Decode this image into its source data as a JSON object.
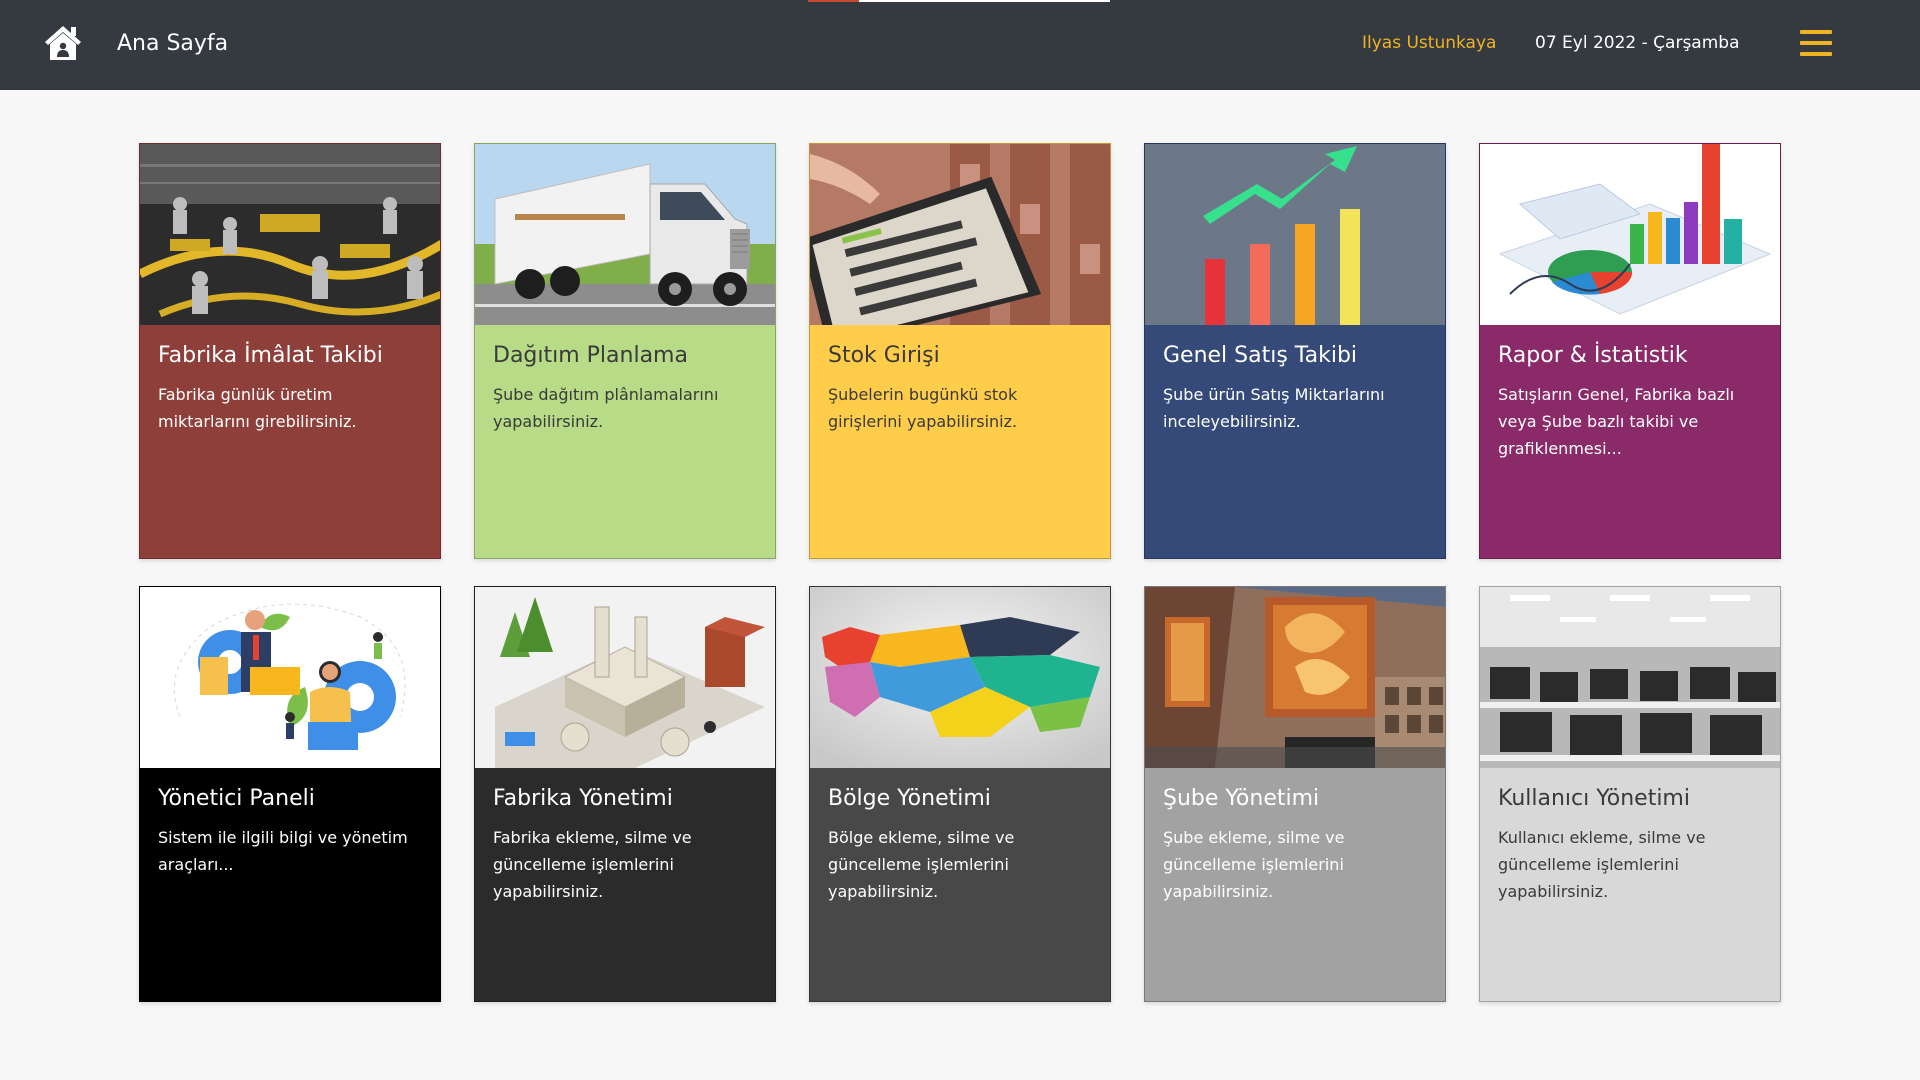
{
  "header": {
    "title": "Ana Sayfa",
    "user": "Ilyas Ustunkaya",
    "date": "07 Eyl 2022 - Çarşamba",
    "icons": {
      "home": "home-icon",
      "menu": "hamburger-menu-icon"
    },
    "colors": {
      "background": "#343a40",
      "user_text": "#f0b321",
      "menu_icon": "#f0b321"
    },
    "loading_progress": 0.17
  },
  "cards": [
    {
      "title": "Fabrika İmâlat Takibi",
      "text": "Fabrika günlük üretim miktarlarını girebilirsiniz.",
      "image": "factory-production-line-photo",
      "bg": "#8e3f3a",
      "fg": "#ffffff"
    },
    {
      "title": "Dağıtım Planlama",
      "text": "Şube dağıtım plânlamalarını yapabilirsiniz.",
      "image": "delivery-truck-photo",
      "bg": "#b7db86",
      "fg": "#3a3a3a"
    },
    {
      "title": "Stok Girişi",
      "text": "Şubelerin bugünkü stok girişlerini yapabilirsiniz.",
      "image": "inventory-tracking-tablet-photo",
      "bg": "#ffcd4a",
      "fg": "#3a3a3a"
    },
    {
      "title": "Genel Satış Takibi",
      "text": "Şube ürün Satış Miktarlarını inceleyebilirsiniz.",
      "image": "sales-growth-bar-chart-illustration",
      "bg": "#354a78",
      "fg": "#ffffff"
    },
    {
      "title": "Rapor & İstatistik",
      "text": "Satışların Genel, Fabrika bazlı veya Şube bazlı takibi ve grafiklenmesi...",
      "image": "report-statistics-3d-charts-illustration",
      "bg": "#8a2a68",
      "fg": "#ffffff"
    },
    {
      "title": "Yönetici Paneli",
      "text": "Sistem ile ilgili bilgi ve yönetim araçları...",
      "image": "admin-team-gears-illustration",
      "bg": "#000000",
      "fg": "#ffffff"
    },
    {
      "title": "Fabrika Yönetimi",
      "text": "Fabrika ekleme, silme ve güncelleme işlemlerini yapabilirsiniz.",
      "image": "isometric-factory-illustration",
      "bg": "#2b2b2b",
      "fg": "#ffffff"
    },
    {
      "title": "Bölge Yönetimi",
      "text": "Bölge ekleme, silme ve güncelleme işlemlerini yapabilirsiniz.",
      "image": "turkey-regions-map-illustration",
      "bg": "#484848",
      "fg": "#ffffff"
    },
    {
      "title": "Şube Yönetimi",
      "text": "Şube ekleme, silme ve güncelleme işlemlerini yapabilirsiniz.",
      "image": "bakery-storefront-photo",
      "bg": "#a2a2a2",
      "fg": "#ffffff"
    },
    {
      "title": "Kullanıcı Yönetimi",
      "text": "Kullanıcı ekleme, silme ve güncelleme işlemlerini yapabilirsiniz.",
      "image": "computer-lab-office-photo",
      "bg": "#d8d8d8",
      "fg": "#3a3a3a"
    }
  ]
}
